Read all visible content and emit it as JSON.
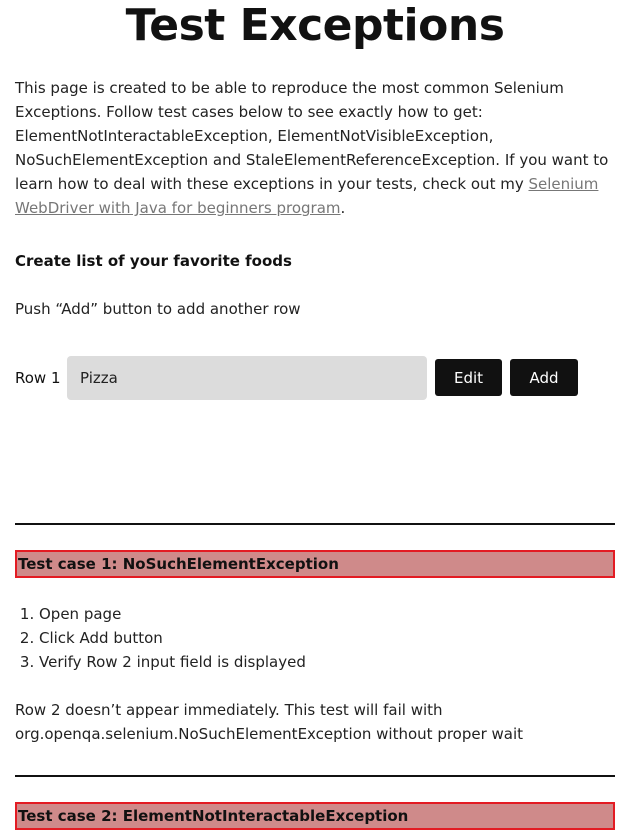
{
  "page": {
    "title": "Test Exceptions",
    "intro_text": "This page is created to be able to reproduce the most common Selenium Exceptions. Follow test cases below to see exactly how to get: ElementNotInteractableException, ElementNotVisibleException, NoSuchElementException and StaleElementReferenceException. If you want to learn how to deal with these exceptions in your tests, check out my ",
    "intro_link": "Selenium WebDriver with Java for beginners program",
    "intro_end": "."
  },
  "foods": {
    "heading": "Create list of your favorite foods",
    "hint": "Push “Add” button to add another row",
    "row1_label": "Row 1",
    "row1_value": "Pizza",
    "edit_label": "Edit",
    "add_label": "Add"
  },
  "test_cases": [
    {
      "heading": "Test case 1: NoSuchElementException",
      "steps": [
        "Open page",
        "Click Add button",
        "Verify Row 2 input field is displayed"
      ],
      "note": "Row 2 doesn’t appear immediately. This test will fail with org.openqa.selenium.NoSuchElementException without proper wait"
    },
    {
      "heading": "Test case 2: ElementNotInteractableException"
    }
  ]
}
